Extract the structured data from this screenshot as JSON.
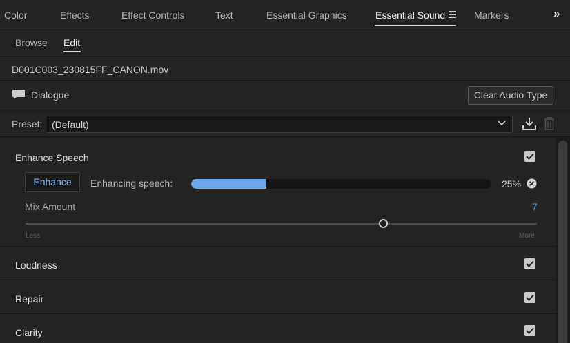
{
  "top_tabs": {
    "items": [
      "Color",
      "Effects",
      "Effect Controls",
      "Text",
      "Essential Graphics",
      "Essential Sound",
      "Markers"
    ],
    "active": "Essential Sound"
  },
  "sub_tabs": {
    "items": [
      "Browse",
      "Edit"
    ],
    "active": "Edit"
  },
  "clip": {
    "name": "D001C003_230815FF_CANON.mov"
  },
  "audio_type": {
    "label": "Dialogue",
    "icon": "speech-bubble-icon",
    "clear_button": "Clear Audio Type"
  },
  "preset": {
    "label": "Preset:",
    "value": "(Default)"
  },
  "sections": {
    "enhance_speech": {
      "title": "Enhance Speech",
      "checked": true,
      "button": "Enhance",
      "status_label": "Enhancing speech:",
      "progress_percent": 25,
      "progress_text": "25%",
      "mix_label": "Mix Amount",
      "mix_value": "7",
      "mix_fraction": 0.7,
      "less_label": "Less",
      "more_label": "More"
    },
    "loudness": {
      "title": "Loudness",
      "checked": true
    },
    "repair": {
      "title": "Repair",
      "checked": true
    },
    "clarity": {
      "title": "Clarity",
      "checked": true
    }
  },
  "colors": {
    "accent": "#69a7ea",
    "link_blue": "#5a9be0",
    "background": "#232323"
  }
}
